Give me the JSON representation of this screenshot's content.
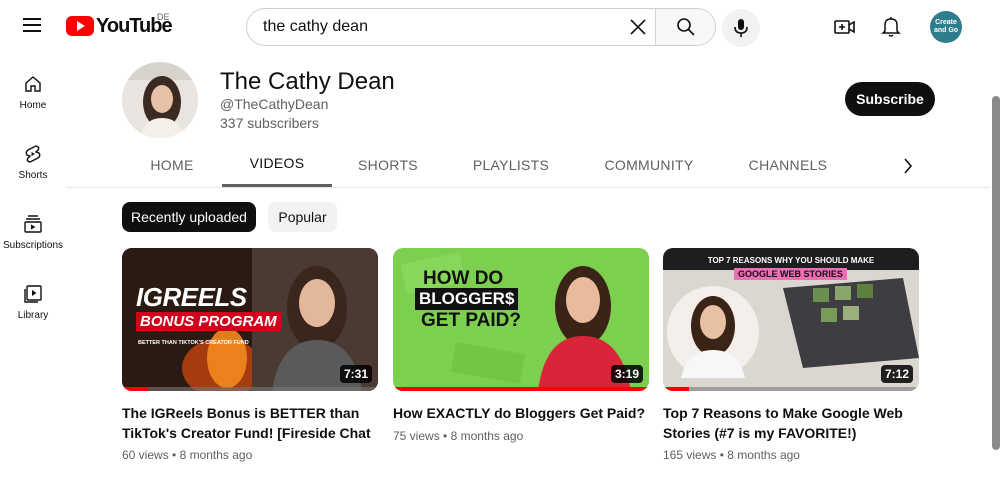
{
  "header": {
    "logo_text": "YouTube",
    "country_code": "DE",
    "search_value": "the cathy dean",
    "avatar_text": "Create and Go"
  },
  "guide": [
    {
      "label": "Home",
      "icon": "home-icon"
    },
    {
      "label": "Shorts",
      "icon": "shorts-icon"
    },
    {
      "label": "Subscriptions",
      "icon": "subscriptions-icon"
    },
    {
      "label": "Library",
      "icon": "library-icon"
    }
  ],
  "channel": {
    "name": "The Cathy Dean",
    "handle": "@TheCathyDean",
    "subscribers": "337 subscribers",
    "subscribe_label": "Subscribe"
  },
  "tabs": [
    "HOME",
    "VIDEOS",
    "SHORTS",
    "PLAYLISTS",
    "COMMUNITY",
    "CHANNELS"
  ],
  "active_tab": "VIDEOS",
  "chips": [
    "Recently uploaded",
    "Popular"
  ],
  "videos": [
    {
      "title": "The IGReels Bonus is BETTER than TikTok's Creator Fund! [Fireside Chat ...",
      "views": "60 views",
      "age": "8 months ago",
      "duration": "7:31",
      "watched_fraction": 0.1,
      "thumb_text": {
        "line1": "IGREELS",
        "line2": "BONUS PROGRAM",
        "line3": "BETTER THAN TIKTOK'S CREATOR FUND"
      }
    },
    {
      "title": "How EXACTLY do Bloggers Get Paid?",
      "views": "75 views",
      "age": "8 months ago",
      "duration": "3:19",
      "watched_fraction": 1.0,
      "thumb_text": {
        "line1": "HOW DO",
        "line2": "BLOGGER$",
        "line3": "GET PAID?"
      }
    },
    {
      "title": "Top 7 Reasons to Make Google Web Stories (#7 is my FAVORITE!)",
      "views": "165 views",
      "age": "8 months ago",
      "duration": "7:12",
      "watched_fraction": 0.1,
      "thumb_text": {
        "line1": "TOP 7 REASONS WHY YOU SHOULD MAKE",
        "line2": "GOOGLE WEB STORIES"
      }
    }
  ],
  "colors": {
    "brand_red": "#ff0000",
    "text": "#0f0f0f",
    "secondary": "#606060"
  }
}
